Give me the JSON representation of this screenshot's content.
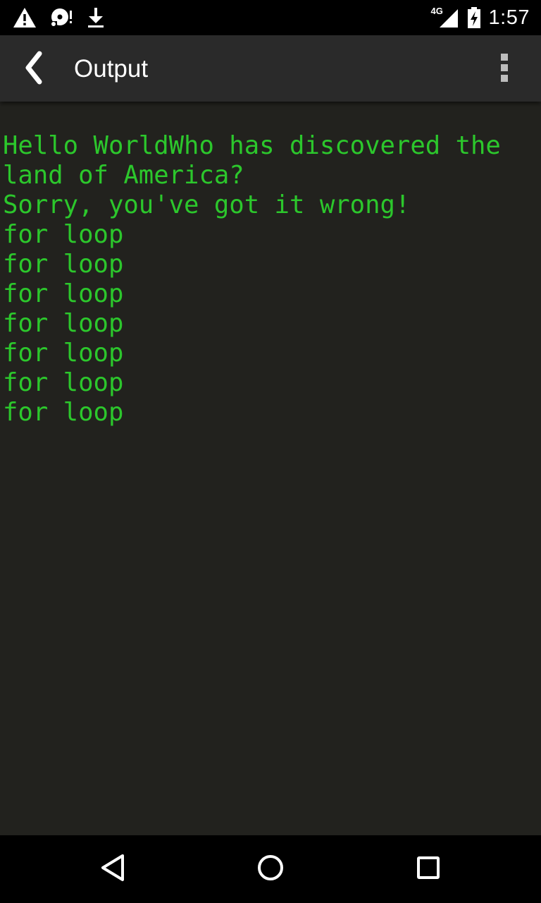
{
  "status_bar": {
    "time": "1:57",
    "network_type": "4G",
    "left_icons": [
      "warning-icon",
      "sd-card-icon",
      "download-icon"
    ],
    "right_icons": [
      "signal-icon",
      "battery-charging-icon"
    ]
  },
  "app_bar": {
    "title": "Output",
    "back_icon": "back-chevron-icon",
    "overflow_icon": "overflow-menu-icon"
  },
  "console": {
    "text_color": "#2cc72c",
    "background": "#22221e",
    "output": "Hello WorldWho has discovered the land of America?\nSorry, you've got it wrong!\nfor loop\nfor loop\nfor loop\nfor loop\nfor loop\nfor loop\nfor loop"
  },
  "nav_bar": {
    "buttons": [
      "back-triangle-icon",
      "home-circle-icon",
      "recents-square-icon"
    ]
  }
}
